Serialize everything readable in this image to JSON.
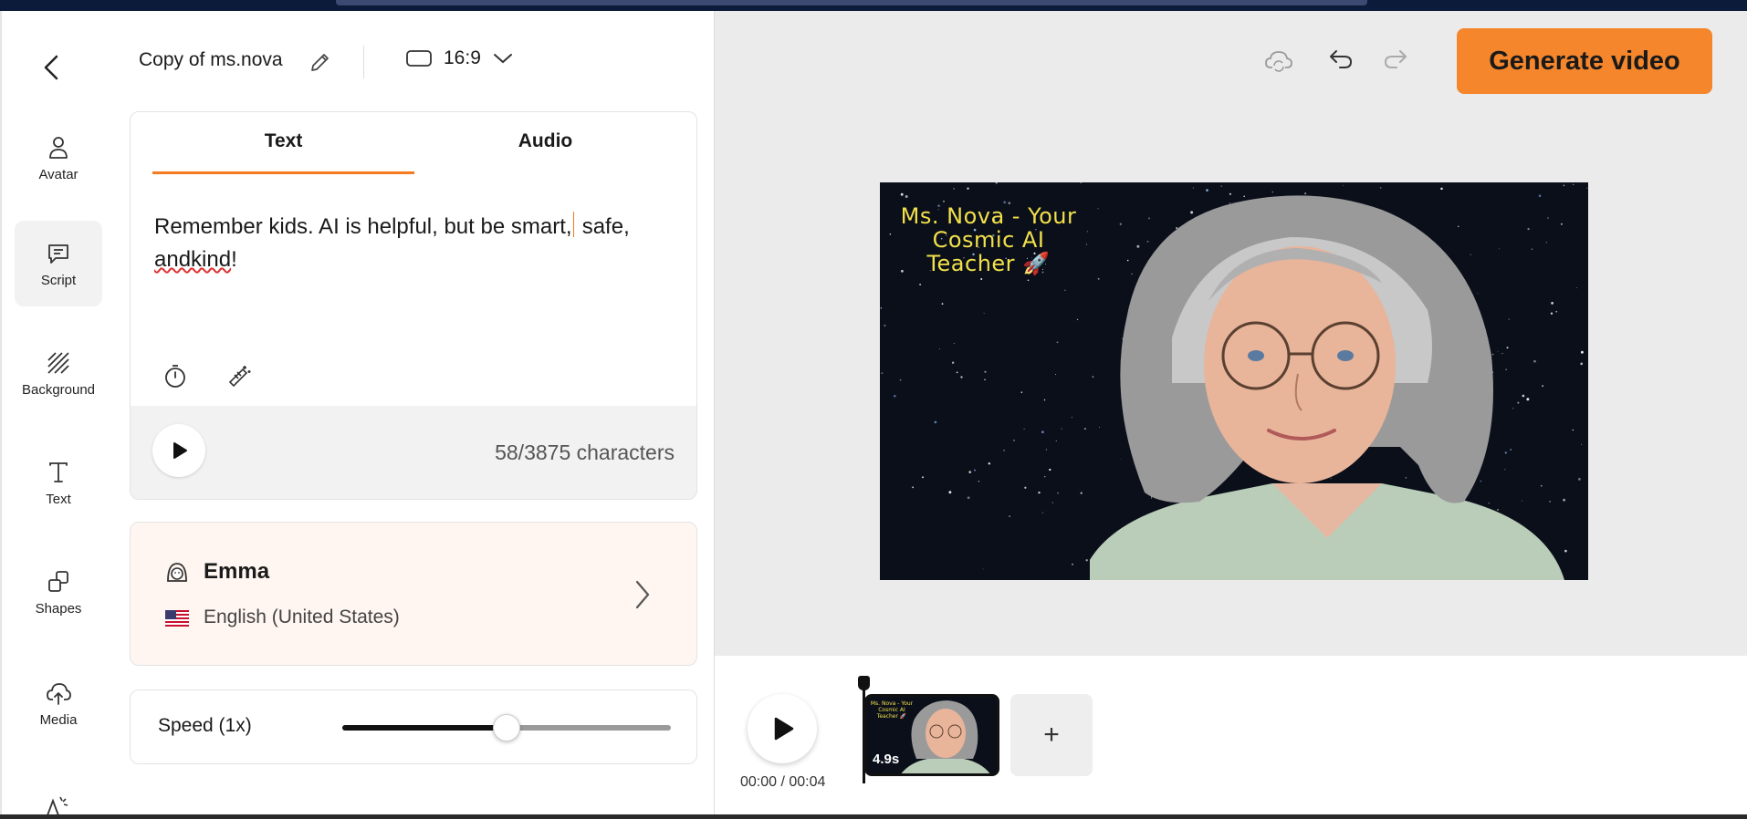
{
  "project": {
    "title": "Copy of ms.nova",
    "aspect_ratio": "16:9"
  },
  "nav": {
    "items": [
      {
        "label": "Avatar",
        "icon": "person-icon"
      },
      {
        "label": "Script",
        "icon": "chat-bubble-icon",
        "active": true
      },
      {
        "label": "Background",
        "icon": "hatch-pattern-icon"
      },
      {
        "label": "Text",
        "icon": "text-t-icon"
      },
      {
        "label": "Shapes",
        "icon": "shapes-icon"
      },
      {
        "label": "Media",
        "icon": "cloud-upload-icon"
      }
    ]
  },
  "script": {
    "tabs": [
      {
        "label": "Text",
        "active": true
      },
      {
        "label": "Audio",
        "active": false
      }
    ],
    "text_before_caret": "Remember kids. AI is helpful, but be smart,",
    "text_after_caret": " safe, ",
    "misspelled_word": "andkind",
    "text_end": "!",
    "char_count": "58/3875 characters"
  },
  "voice": {
    "name": "Emma",
    "language": "English (United States)"
  },
  "speed": {
    "label": "Speed (1x)",
    "value_fraction": 0.5
  },
  "toolbar": {
    "generate_label": "Generate video"
  },
  "preview": {
    "title_overlay": "Ms. Nova - Your Cosmic AI Teacher 🚀"
  },
  "timeline": {
    "timecode": "00:00 / 00:04",
    "clip_duration": "4.9s",
    "add_label": "+"
  },
  "colors": {
    "accent": "#f47b20",
    "generate_button": "#f5862b",
    "overlay_text": "#f2e04a",
    "voice_card_bg": "#fff6f1"
  }
}
